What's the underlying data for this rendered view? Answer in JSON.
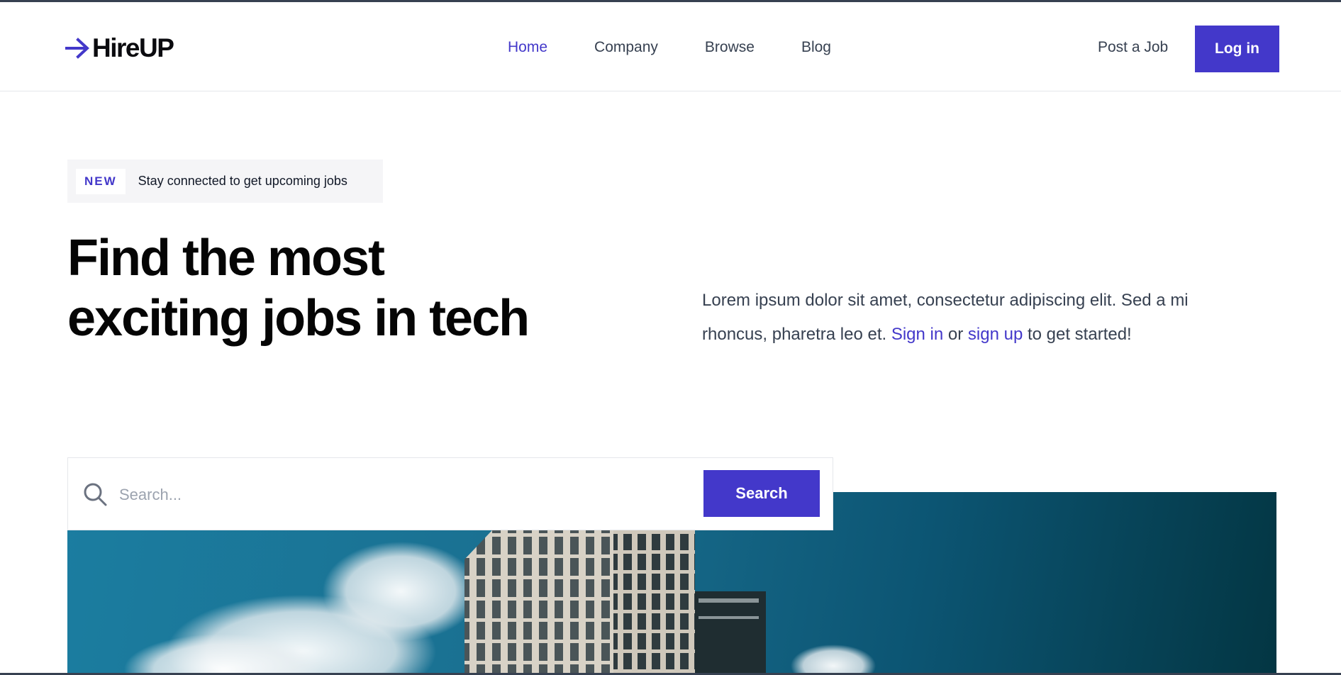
{
  "brand": {
    "name": "HireUP",
    "logo_icon": "arrow-right-icon",
    "accent": "#4338ca"
  },
  "nav": {
    "items": [
      {
        "label": "Home",
        "active": true
      },
      {
        "label": "Company",
        "active": false
      },
      {
        "label": "Browse",
        "active": false
      },
      {
        "label": "Blog",
        "active": false
      }
    ],
    "post_job": "Post a Job",
    "login": "Log in"
  },
  "hero": {
    "badge": "NEW",
    "badge_text": "Stay connected to get upcoming jobs",
    "title_line1": "Find the most",
    "title_line2": "exciting jobs in tech",
    "desc_prefix": "Lorem ipsum dolor sit amet, consectetur adipiscing elit. Sed a mi rhoncus, pharetra leo et. ",
    "sign_in": "Sign in",
    "or_text": " or ",
    "sign_up": "sign up",
    "desc_suffix": " to get started!"
  },
  "search": {
    "placeholder": "Search...",
    "value": "",
    "button": "Search",
    "icon": "search-icon"
  }
}
